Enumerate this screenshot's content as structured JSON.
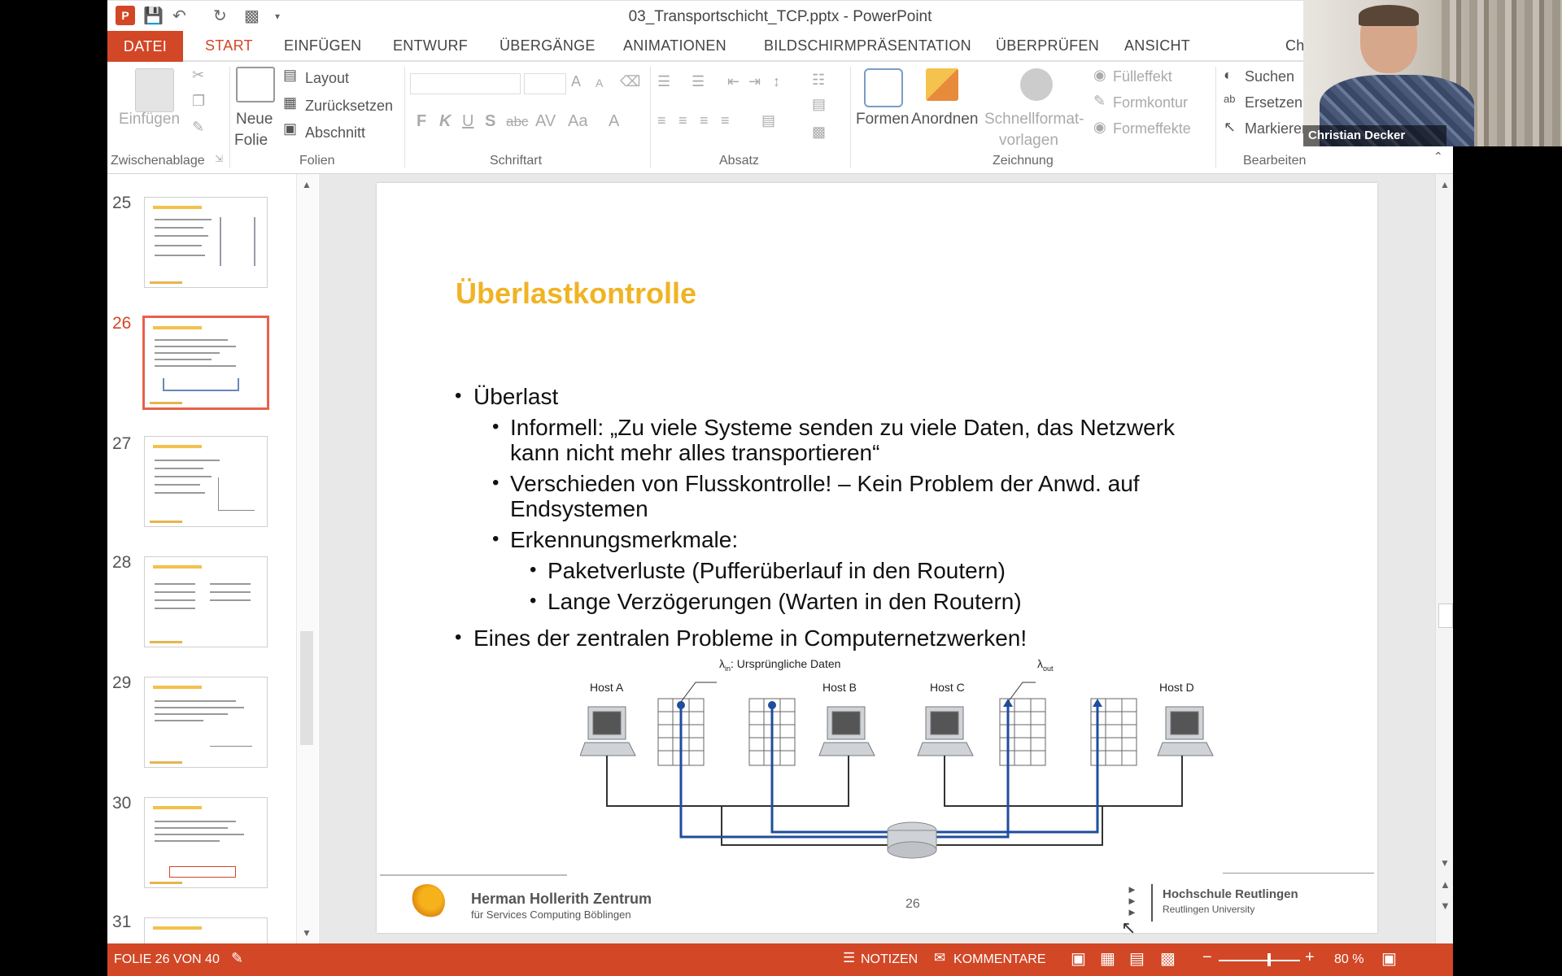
{
  "window": {
    "title": "03_Transportschicht_TCP.pptx - PowerPoint"
  },
  "tabs": [
    "DATEI",
    "START",
    "EINFÜGEN",
    "ENTWURF",
    "ÜBERGÄNGE",
    "ANIMATIONEN",
    "BILDSCHIRMPRÄSENTATION",
    "ÜBERPRÜFEN",
    "ANSICHT",
    "Ch"
  ],
  "ribbon": {
    "clipboard": {
      "paste": "Einfügen",
      "group": "Zwischenablage"
    },
    "slides": {
      "new_slide_1": "Neue",
      "new_slide_2": "Folie",
      "layout": "Layout",
      "reset": "Zurücksetzen",
      "section": "Abschnitt",
      "group": "Folien"
    },
    "font": {
      "group": "Schriftart",
      "bold": "F",
      "italic": "K",
      "underline": "U",
      "shadow": "S",
      "strike": "abc",
      "spacing": "AV",
      "case": "Aa",
      "color": "A",
      "grow": "A",
      "shrink": "A"
    },
    "paragraph": {
      "group": "Absatz"
    },
    "drawing": {
      "shapes": "Formen",
      "arrange": "Anordnen",
      "styles_1": "Schnellformat-",
      "styles_2": "vorlagen",
      "fill": "Fülleffekt",
      "outline": "Formkontur",
      "effects": "Formeffekte",
      "group": "Zeichnung"
    },
    "editing": {
      "find": "Suchen",
      "replace": "Ersetzen",
      "select": "Markieren",
      "group": "Bearbeiten"
    }
  },
  "thumbnails": [
    {
      "num": "25",
      "selected": false
    },
    {
      "num": "26",
      "selected": true
    },
    {
      "num": "27",
      "selected": false
    },
    {
      "num": "28",
      "selected": false
    },
    {
      "num": "29",
      "selected": false
    },
    {
      "num": "30",
      "selected": false
    },
    {
      "num": "31",
      "selected": false
    }
  ],
  "slide": {
    "title": "Überlastkontrolle",
    "bullets": {
      "b1": "Überlast",
      "b1_1a": "Informell: „Zu viele Systeme senden zu viele Daten, das Netzwerk",
      "b1_1b": "kann nicht mehr alles transportieren“",
      "b1_2a": "Verschieden von Flusskontrolle! – Kein Problem der Anwd. auf",
      "b1_2b": "Endsystemen",
      "b1_3": "Erkennungsmerkmale:",
      "b1_3_1": "Paketverluste (Pufferüberlauf in den Routern)",
      "b1_3_2": "Lange Verzögerungen (Warten in den Routern)",
      "b2": "Eines der zentralen Probleme in Computernetzwerken!"
    },
    "diagram": {
      "host_a": "Host A",
      "host_b": "Host B",
      "host_c": "Host C",
      "host_d": "Host D",
      "lambda_in": "λ",
      "lambda_in_sub": "in",
      "lambda_in_text": ": Ursprüngliche Daten",
      "lambda_out": "λ",
      "lambda_out_sub": "out"
    },
    "footer": {
      "logo_left_1": "Herman Hollerith Zentrum",
      "logo_left_2": "für Services Computing Böblingen",
      "page": "26",
      "logo_right_1": "Hochschule Reutlingen",
      "logo_right_2": "Reutlingen University"
    }
  },
  "status": {
    "slide_of": "FOLIE 26 VON 40",
    "notes": "NOTIZEN",
    "comments": "KOMMENTARE",
    "zoom": "80 %"
  },
  "webcam": {
    "name": "Christian Decker"
  },
  "colors": {
    "accent": "#d24726",
    "title": "#f0b323",
    "link": "#1f4e9c"
  }
}
